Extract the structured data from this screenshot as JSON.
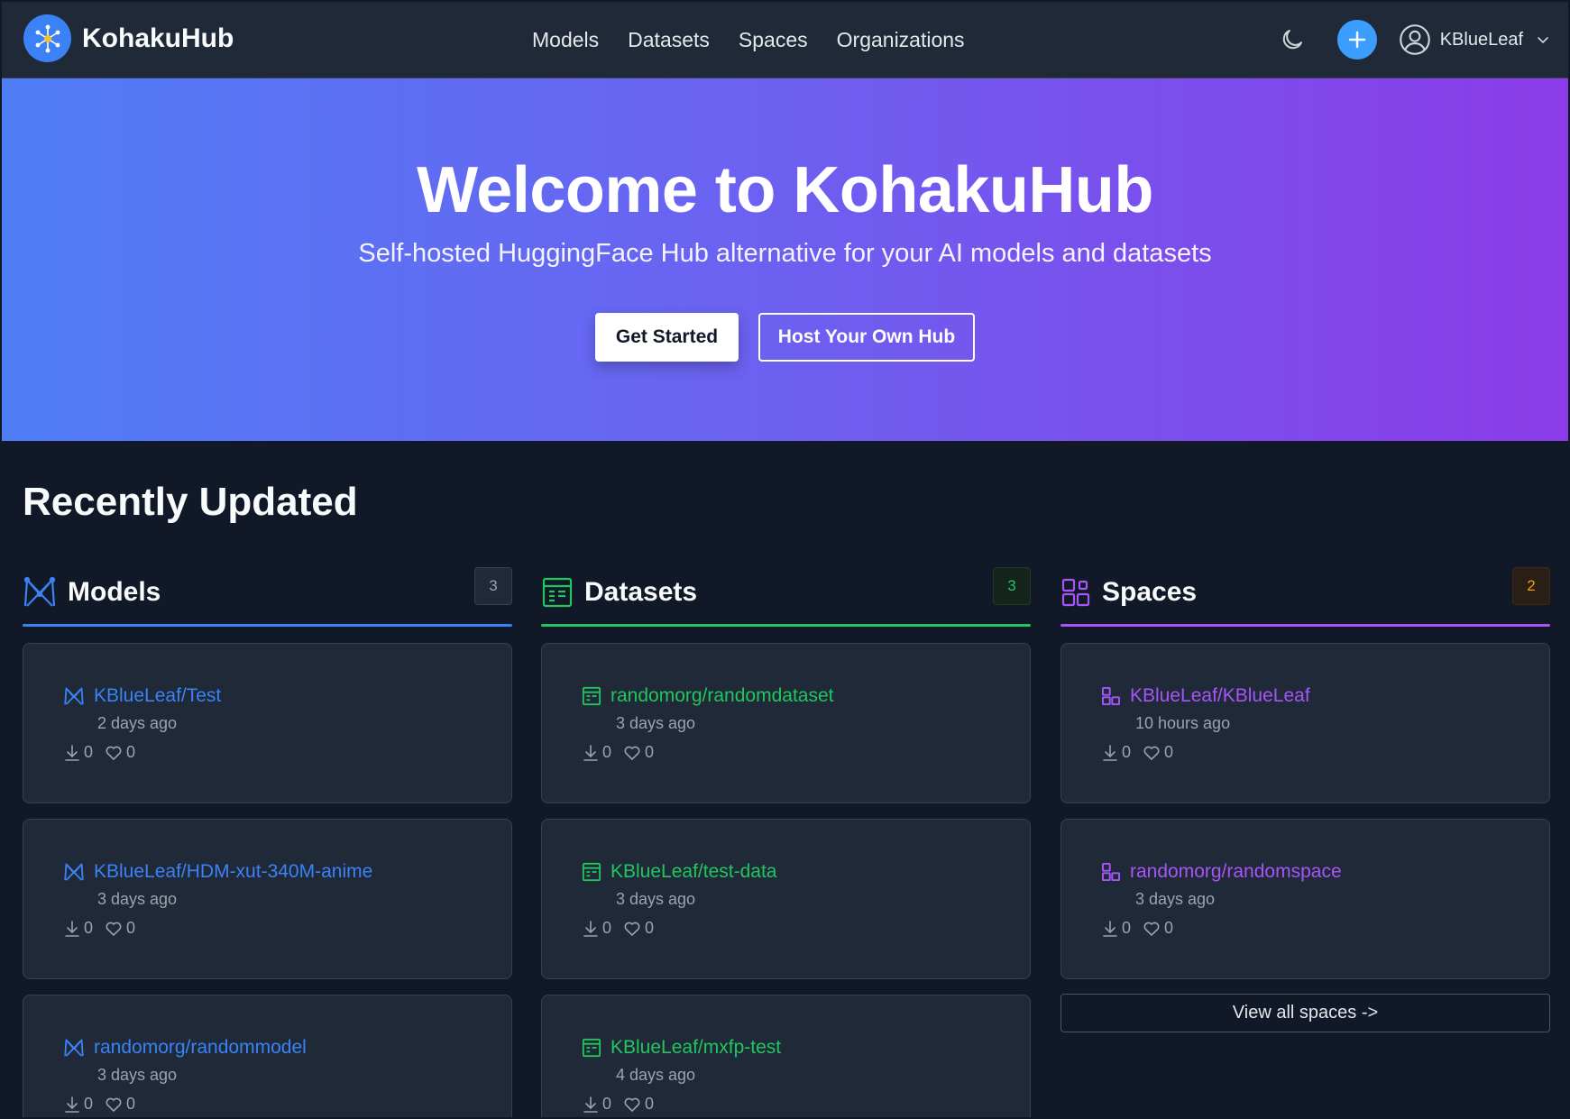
{
  "header": {
    "brand": "KohakuHub",
    "nav": [
      "Models",
      "Datasets",
      "Spaces",
      "Organizations"
    ],
    "username": "KBlueLeaf"
  },
  "hero": {
    "title": "Welcome to KohakuHub",
    "subtitle": "Self-hosted HuggingFace Hub alternative for your AI models and datasets",
    "primary_button": "Get Started",
    "secondary_button": "Host Your Own Hub"
  },
  "recent": {
    "title": "Recently Updated",
    "models": {
      "title": "Models",
      "count": "3",
      "accent": "#3b82f6",
      "items": [
        {
          "name": "KBlueLeaf/Test",
          "time": "2 days ago",
          "downloads": "0",
          "likes": "0"
        },
        {
          "name": "KBlueLeaf/HDM-xut-340M-anime",
          "time": "3 days ago",
          "downloads": "0",
          "likes": "0"
        },
        {
          "name": "randomorg/randommodel",
          "time": "3 days ago",
          "downloads": "0",
          "likes": "0"
        }
      ]
    },
    "datasets": {
      "title": "Datasets",
      "count": "3",
      "accent": "#22c55e",
      "items": [
        {
          "name": "randomorg/randomdataset",
          "time": "3 days ago",
          "downloads": "0",
          "likes": "0"
        },
        {
          "name": "KBlueLeaf/test-data",
          "time": "3 days ago",
          "downloads": "0",
          "likes": "0"
        },
        {
          "name": "KBlueLeaf/mxfp-test",
          "time": "4 days ago",
          "downloads": "0",
          "likes": "0"
        }
      ]
    },
    "spaces": {
      "title": "Spaces",
      "count": "2",
      "accent": "#a855f7",
      "items": [
        {
          "name": "KBlueLeaf/KBlueLeaf",
          "time": "10 hours ago",
          "downloads": "0",
          "likes": "0"
        },
        {
          "name": "randomorg/randomspace",
          "time": "3 days ago",
          "downloads": "0",
          "likes": "0"
        }
      ],
      "view_all": "View all spaces ->"
    }
  }
}
